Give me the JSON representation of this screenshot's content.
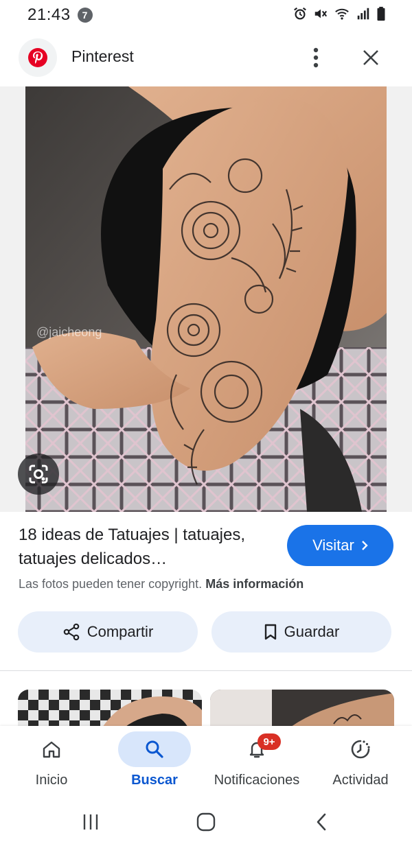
{
  "status_bar": {
    "time": "21:43",
    "notification_count": "7",
    "icons": [
      "alarm-icon",
      "mute-icon",
      "wifi-icon",
      "signal-icon",
      "battery-icon"
    ]
  },
  "header": {
    "site_name": "Pinterest",
    "logo_icon": "pinterest-logo",
    "more_icon": "more-vert-icon",
    "close_icon": "close-icon"
  },
  "image": {
    "watermark": "@jaicheong",
    "lens_icon": "google-lens-icon"
  },
  "result": {
    "title": "18 ideas de Tatuajes | tatuajes, tatuajes delicados…",
    "visit_label": "Visitar",
    "copyright_text": "Las fotos pueden tener copyright.",
    "more_info_label": "Más información"
  },
  "actions": {
    "share_label": "Compartir",
    "save_label": "Guardar"
  },
  "bottom_nav": {
    "items": [
      {
        "label": "Inicio",
        "icon": "home-icon",
        "active": false
      },
      {
        "label": "Buscar",
        "icon": "search-icon",
        "active": true
      },
      {
        "label": "Notificaciones",
        "icon": "bell-icon",
        "active": false,
        "badge": "9+"
      },
      {
        "label": "Actividad",
        "icon": "activity-icon",
        "active": false
      }
    ]
  },
  "colors": {
    "accent": "#1a73e8",
    "active_nav": "#0b57d0",
    "pinterest_red": "#e60023",
    "badge_red": "#d93025"
  }
}
